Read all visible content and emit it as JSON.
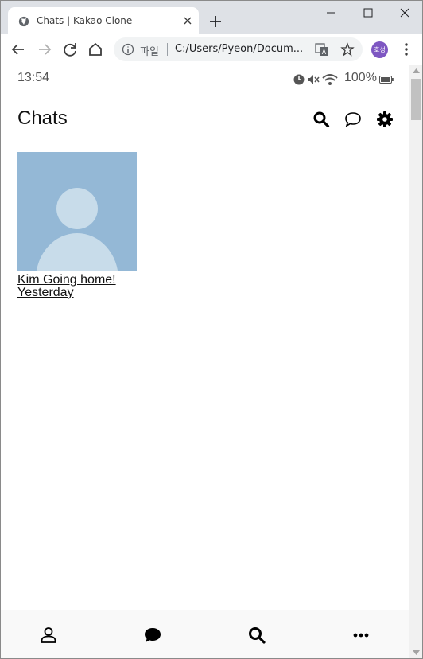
{
  "browser": {
    "tab_title": "Chats | Kakao Clone",
    "url_scheme": "파일",
    "url": "C:/Users/Pyeon/Docum...",
    "profile_initials": "호성",
    "icons": [
      "globe-icon",
      "close-icon",
      "plus-icon",
      "minimize-icon",
      "maximize-icon",
      "close-window-icon",
      "back-arrow-icon",
      "forward-arrow-icon",
      "reload-icon",
      "home-icon",
      "info-icon",
      "translate-icon",
      "star-icon",
      "menu-dots-icon"
    ]
  },
  "status_bar": {
    "time": "13:54",
    "battery": "100%",
    "icons": [
      "alarm-icon",
      "mute-icon",
      "wifi-icon",
      "battery-icon"
    ]
  },
  "header": {
    "title": "Chats",
    "icons": [
      "search-icon",
      "chat-bubble-icon",
      "gear-icon"
    ]
  },
  "chats": [
    {
      "name_and_preview": "Kim Going home!",
      "time": "Yesterday",
      "avatar_color": "#94b8d6"
    }
  ],
  "tab_bar": {
    "icons": [
      "person-icon",
      "chat-bubble-filled-icon",
      "search-icon",
      "more-dots-icon"
    ]
  },
  "colors": {
    "chrome_tabstrip": "#dee1e6",
    "omnibox": "#f1f3f4",
    "avatar_bg": "#94b8d6",
    "avatar_fg": "#c8dcea",
    "profile_chip": "#7e57c2"
  }
}
